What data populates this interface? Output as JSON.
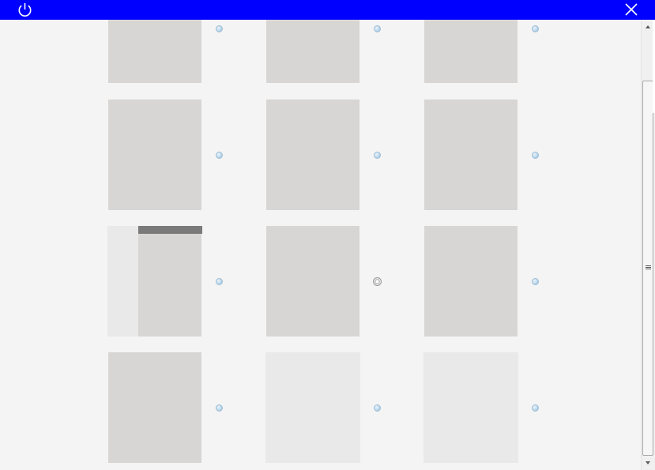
{
  "window": {
    "titlebar_color": "#0000ff",
    "power_icon": "power-icon",
    "close_icon": "close-icon"
  },
  "grid": {
    "thumbnail_color": "#d8d6d4",
    "empty_thumbnail_color": "#e9e9e9",
    "rows": [
      {
        "cells": [
          {
            "kind": "page",
            "selected": false
          },
          {
            "kind": "page",
            "selected": false
          },
          {
            "kind": "page",
            "selected": false
          }
        ]
      },
      {
        "cells": [
          {
            "kind": "page",
            "selected": false
          },
          {
            "kind": "page",
            "selected": false
          },
          {
            "kind": "page",
            "selected": false
          }
        ]
      },
      {
        "cells": [
          {
            "kind": "page-with-sidebar",
            "selected": false
          },
          {
            "kind": "page",
            "selected": true
          },
          {
            "kind": "page",
            "selected": false
          }
        ]
      },
      {
        "cells": [
          {
            "kind": "page",
            "selected": false
          },
          {
            "kind": "blank",
            "selected": false
          },
          {
            "kind": "blank",
            "selected": false
          }
        ]
      }
    ]
  },
  "scrollbar": {
    "up_icon": "scroll-up-arrow-icon",
    "down_icon": "scroll-down-arrow-icon",
    "scroll_fraction": 0.12
  }
}
